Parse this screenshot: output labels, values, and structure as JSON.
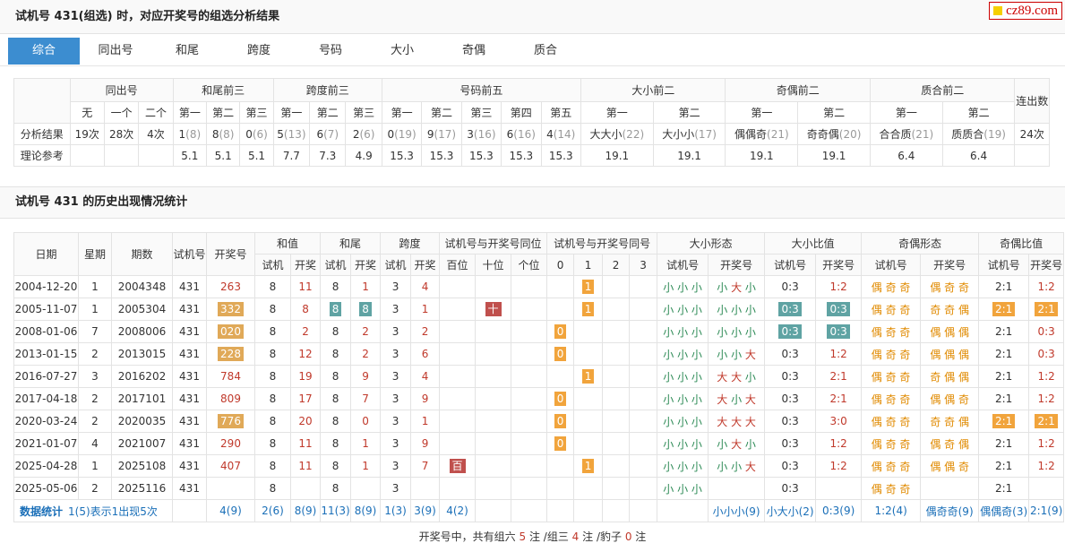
{
  "header": {
    "title": "试机号 431(组选) 时，对应开奖号的组选分析结果"
  },
  "logo": {
    "text": "cz89.com"
  },
  "tabs": [
    "综合",
    "同出号",
    "和尾",
    "跨度",
    "号码",
    "大小",
    "奇偶",
    "质合"
  ],
  "analysis": {
    "groups": [
      "同出号",
      "和尾前三",
      "跨度前三",
      "号码前五",
      "大小前二",
      "奇偶前二",
      "质合前二",
      "连出数"
    ],
    "sub": [
      "无",
      "一个",
      "二个",
      "第一",
      "第二",
      "第三",
      "第一",
      "第二",
      "第三",
      "第一",
      "第二",
      "第三",
      "第四",
      "第五",
      "第一",
      "第二",
      "第一",
      "第二",
      "第一",
      "第二"
    ],
    "row_label_result": "分析结果",
    "row_label_theory": "理论参考",
    "result": [
      [
        "19次",
        ""
      ],
      [
        "28次",
        ""
      ],
      [
        "4次",
        ""
      ],
      [
        "1",
        "(8)"
      ],
      [
        "8",
        "(8)"
      ],
      [
        "0",
        "(6)"
      ],
      [
        "5",
        "(13)"
      ],
      [
        "6",
        "(7)"
      ],
      [
        "2",
        "(6)"
      ],
      [
        "0",
        "(19)"
      ],
      [
        "9",
        "(17)"
      ],
      [
        "3",
        "(16)"
      ],
      [
        "6",
        "(16)"
      ],
      [
        "4",
        "(14)"
      ],
      [
        "大大小",
        "(22)"
      ],
      [
        "大小小",
        "(17)"
      ],
      [
        "偶偶奇",
        "(21)"
      ],
      [
        "奇奇偶",
        "(20)"
      ],
      [
        "合合质",
        "(21)"
      ],
      [
        "质质合",
        "(19)"
      ],
      [
        "24次",
        ""
      ]
    ],
    "theory": [
      "",
      "",
      "",
      "5.1",
      "5.1",
      "5.1",
      "7.7",
      "7.3",
      "4.9",
      "15.3",
      "15.3",
      "15.3",
      "15.3",
      "15.3",
      "19.1",
      "19.1",
      "19.1",
      "19.1",
      "6.4",
      "6.4",
      ""
    ]
  },
  "history_title": "试机号 431 的历史出现情况统计",
  "history": {
    "head1": [
      "日期",
      "星期",
      "期数",
      "试机号",
      "开奖号",
      "和值",
      "和尾",
      "跨度",
      "试机号与开奖号同位",
      "试机号与开奖号同号",
      "大小形态",
      "大小比值",
      "奇偶形态",
      "奇偶比值"
    ],
    "head2": [
      "试机",
      "开奖",
      "试机",
      "开奖",
      "试机",
      "开奖",
      "百位",
      "十位",
      "个位",
      "0",
      "1",
      "2",
      "3",
      "试机号",
      "开奖号",
      "试机号",
      "开奖号",
      "试机号",
      "开奖号",
      "试机号",
      "开奖号"
    ],
    "rows": [
      {
        "date": "2004-12-20",
        "wk": "1",
        "issue": "2004348",
        "sj": "431",
        "kj": "263",
        "kjb": false,
        "hs": "8",
        "hk": "11",
        "ws": "8",
        "wk2": "1",
        "wb": false,
        "ks": "3",
        "kk": "4",
        "pos": [
          "",
          "",
          ""
        ],
        "same": [
          "",
          "1",
          "",
          ""
        ],
        "dxs": "小 小 小",
        "dxk": "小 大 小",
        "dbs": "0:3",
        "dbk": "1:2",
        "dbb": false,
        "jos": "偶 奇 奇",
        "jok": "偶 奇 奇",
        "jbs": "2:1",
        "jbk": "1:2",
        "jbb": false
      },
      {
        "date": "2005-11-07",
        "wk": "1",
        "issue": "2005304",
        "sj": "431",
        "kj": "332",
        "kjb": true,
        "hs": "8",
        "hk": "8",
        "ws": "8",
        "wk2": "8",
        "wb": true,
        "ks": "3",
        "kk": "1",
        "pos": [
          "",
          "十",
          ""
        ],
        "same": [
          "",
          "1",
          "",
          ""
        ],
        "dxs": "小 小 小",
        "dxk": "小 小 小",
        "dbs": "0:3",
        "dbk": "0:3",
        "dbb": true,
        "jos": "偶 奇 奇",
        "jok": "奇 奇 偶",
        "jbs": "2:1",
        "jbk": "2:1",
        "jbb": true
      },
      {
        "date": "2008-01-06",
        "wk": "7",
        "issue": "2008006",
        "sj": "431",
        "kj": "020",
        "kjb": true,
        "hs": "8",
        "hk": "2",
        "ws": "8",
        "wk2": "2",
        "wb": false,
        "ks": "3",
        "kk": "2",
        "pos": [
          "",
          "",
          ""
        ],
        "same": [
          "0",
          "",
          "",
          ""
        ],
        "dxs": "小 小 小",
        "dxk": "小 小 小",
        "dbs": "0:3",
        "dbk": "0:3",
        "dbb": true,
        "jos": "偶 奇 奇",
        "jok": "偶 偶 偶",
        "jbs": "2:1",
        "jbk": "0:3",
        "jbb": false
      },
      {
        "date": "2013-01-15",
        "wk": "2",
        "issue": "2013015",
        "sj": "431",
        "kj": "228",
        "kjb": true,
        "hs": "8",
        "hk": "12",
        "ws": "8",
        "wk2": "2",
        "wb": false,
        "ks": "3",
        "kk": "6",
        "pos": [
          "",
          "",
          ""
        ],
        "same": [
          "0",
          "",
          "",
          ""
        ],
        "dxs": "小 小 小",
        "dxk": "小 小 大",
        "dbs": "0:3",
        "dbk": "1:2",
        "dbb": false,
        "jos": "偶 奇 奇",
        "jok": "偶 偶 偶",
        "jbs": "2:1",
        "jbk": "0:3",
        "jbb": false
      },
      {
        "date": "2016-07-27",
        "wk": "3",
        "issue": "2016202",
        "sj": "431",
        "kj": "784",
        "kjb": false,
        "hs": "8",
        "hk": "19",
        "ws": "8",
        "wk2": "9",
        "wb": false,
        "ks": "3",
        "kk": "4",
        "pos": [
          "",
          "",
          ""
        ],
        "same": [
          "",
          "1",
          "",
          ""
        ],
        "dxs": "小 小 小",
        "dxk": "大 大 小",
        "dbs": "0:3",
        "dbk": "2:1",
        "dbb": false,
        "jos": "偶 奇 奇",
        "jok": "奇 偶 偶",
        "jbs": "2:1",
        "jbk": "1:2",
        "jbb": false
      },
      {
        "date": "2017-04-18",
        "wk": "2",
        "issue": "2017101",
        "sj": "431",
        "kj": "809",
        "kjb": false,
        "hs": "8",
        "hk": "17",
        "ws": "8",
        "wk2": "7",
        "wb": false,
        "ks": "3",
        "kk": "9",
        "pos": [
          "",
          "",
          ""
        ],
        "same": [
          "0",
          "",
          "",
          ""
        ],
        "dxs": "小 小 小",
        "dxk": "大 小 大",
        "dbs": "0:3",
        "dbk": "2:1",
        "dbb": false,
        "jos": "偶 奇 奇",
        "jok": "偶 偶 奇",
        "jbs": "2:1",
        "jbk": "1:2",
        "jbb": false
      },
      {
        "date": "2020-03-24",
        "wk": "2",
        "issue": "2020035",
        "sj": "431",
        "kj": "776",
        "kjb": true,
        "hs": "8",
        "hk": "20",
        "ws": "8",
        "wk2": "0",
        "wb": false,
        "ks": "3",
        "kk": "1",
        "pos": [
          "",
          "",
          ""
        ],
        "same": [
          "0",
          "",
          "",
          ""
        ],
        "dxs": "小 小 小",
        "dxk": "大 大 大",
        "dbs": "0:3",
        "dbk": "3:0",
        "dbb": false,
        "jos": "偶 奇 奇",
        "jok": "奇 奇 偶",
        "jbs": "2:1",
        "jbk": "2:1",
        "jbb": true
      },
      {
        "date": "2021-01-07",
        "wk": "4",
        "issue": "2021007",
        "sj": "431",
        "kj": "290",
        "kjb": false,
        "hs": "8",
        "hk": "11",
        "ws": "8",
        "wk2": "1",
        "wb": false,
        "ks": "3",
        "kk": "9",
        "pos": [
          "",
          "",
          ""
        ],
        "same": [
          "0",
          "",
          "",
          ""
        ],
        "dxs": "小 小 小",
        "dxk": "小 大 小",
        "dbs": "0:3",
        "dbk": "1:2",
        "dbb": false,
        "jos": "偶 奇 奇",
        "jok": "偶 奇 偶",
        "jbs": "2:1",
        "jbk": "1:2",
        "jbb": false
      },
      {
        "date": "2025-04-28",
        "wk": "1",
        "issue": "2025108",
        "sj": "431",
        "kj": "407",
        "kjb": false,
        "hs": "8",
        "hk": "11",
        "ws": "8",
        "wk2": "1",
        "wb": false,
        "ks": "3",
        "kk": "7",
        "pos": [
          "百",
          "",
          ""
        ],
        "same": [
          "",
          "1",
          "",
          ""
        ],
        "dxs": "小 小 小",
        "dxk": "小 小 大",
        "dbs": "0:3",
        "dbk": "1:2",
        "dbb": false,
        "jos": "偶 奇 奇",
        "jok": "偶 偶 奇",
        "jbs": "2:1",
        "jbk": "1:2",
        "jbb": false
      },
      {
        "date": "2025-05-06",
        "wk": "2",
        "issue": "2025116",
        "sj": "431",
        "kj": "",
        "kjb": false,
        "hs": "8",
        "hk": "",
        "ws": "8",
        "wk2": "",
        "wb": false,
        "ks": "3",
        "kk": "",
        "pos": [
          "",
          "",
          ""
        ],
        "same": [
          "",
          "",
          "",
          ""
        ],
        "dxs": "小 小 小",
        "dxk": "",
        "dbs": "0:3",
        "dbk": "",
        "dbb": false,
        "jos": "偶 奇 奇",
        "jok": "",
        "jbs": "2:1",
        "jbk": "",
        "jbb": false
      }
    ],
    "stats": {
      "label": "数据统计",
      "desc": "1(5)表示1出现5次",
      "cells": [
        "4(9)",
        "2(6)",
        "8(9)",
        "11(3)",
        "8(9)",
        "1(3)",
        "3(9)",
        "4(2)",
        "",
        "",
        "",
        "",
        "",
        "",
        "",
        "小小小(9)",
        "小大小(2)",
        "0:3(9)",
        "1:2(4)",
        "偶奇奇(9)",
        "偶偶奇(3)",
        "2:1(9)",
        "1:2(5)"
      ]
    }
  },
  "footer": {
    "prefix": "开奖号中，共有组六",
    "n6": "5",
    "mid1": "注 /组三",
    "n3": "4",
    "mid2": "注 /豹子",
    "nb": "0",
    "suffix": "注"
  }
}
